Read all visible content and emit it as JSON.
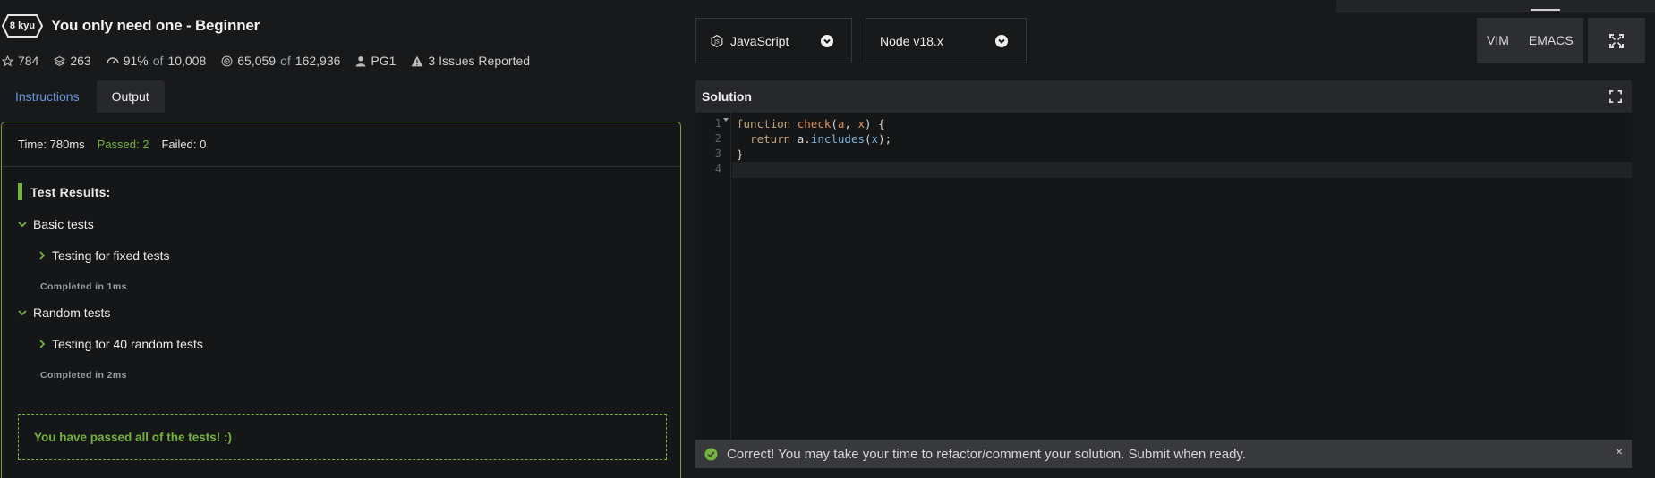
{
  "colors": {
    "accent_green": "#75b33f",
    "panel_border": "#77a141",
    "link_blue": "#6795de"
  },
  "kata": {
    "rank": "8 kyu",
    "title": "You only need one - Beginner"
  },
  "stats": {
    "stars": "784",
    "collections": "263",
    "satisfaction_pct": "91%",
    "satisfaction_of": "of",
    "satisfaction_votes": "10,008",
    "completed": "65,059",
    "completed_of": "of",
    "attempted": "162,936",
    "author": "PG1",
    "issues": "3 Issues Reported"
  },
  "tabs": {
    "instructions": "Instructions",
    "output": "Output"
  },
  "output": {
    "time": "Time: 780ms",
    "passed": "Passed: 2",
    "failed": "Failed: 0",
    "results_heading": "Test Results:",
    "groups": [
      {
        "name": "Basic tests",
        "test": "Testing for fixed tests",
        "completed": "Completed in 1ms"
      },
      {
        "name": "Random tests",
        "test": "Testing for 40 random tests",
        "completed": "Completed in 2ms"
      }
    ],
    "pass_message": "You have passed all of the tests! :)"
  },
  "toolbar": {
    "language": "JavaScript",
    "runtime": "Node v18.x",
    "vim": "VIM",
    "emacs": "EMACS"
  },
  "editor": {
    "title": "Solution",
    "line_numbers": [
      "1",
      "2",
      "3",
      "4"
    ],
    "code": {
      "l1_kw": "function",
      "l1_fn": "check",
      "l1_open": "(",
      "l1_a": "a",
      "l1_comma": ", ",
      "l1_x": "x",
      "l1_close": ") {",
      "l2_kw": "  return",
      "l2_obj": " a.",
      "l2_method": "includes",
      "l2_open": "(",
      "l2_x": "x",
      "l2_close": ");",
      "l3": "}"
    }
  },
  "notice": {
    "message": "Correct! You may take your time to refactor/comment your solution. Submit when ready.",
    "close": "×"
  }
}
